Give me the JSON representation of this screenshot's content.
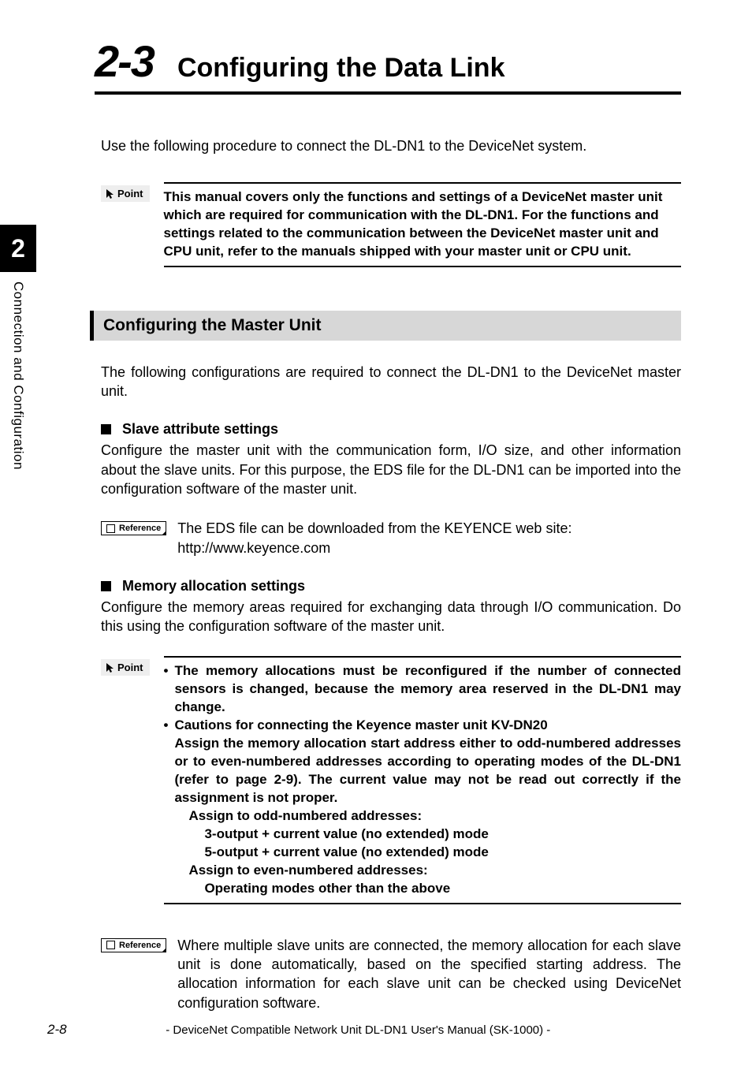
{
  "section_number": "2-3",
  "section_title": "Configuring the Data Link",
  "intro": "Use the following procedure to connect the DL-DN1 to the DeviceNet system.",
  "point_label": "Point",
  "point1_text": "This manual covers only the functions and settings of a DeviceNet master unit which are required for communication with the DL-DN1. For the functions and settings related to the communication between the DeviceNet master unit and CPU unit, refer to the manuals shipped with your master unit or CPU unit.",
  "subsection_title": "Configuring the Master Unit",
  "subsection_intro": "The following configurations are required to connect the DL-DN1 to the DeviceNet master unit.",
  "slave_heading": "Slave attribute settings",
  "slave_body": "Configure the master unit with the communication form, I/O size, and other information about the slave units. For this purpose, the EDS file for the DL-DN1 can be imported into the configuration software of the master unit.",
  "reference_label": "Reference",
  "ref1_line1": "The EDS file can be downloaded from the KEYENCE web site:",
  "ref1_line2": "http://www.keyence.com",
  "memory_heading": "Memory allocation settings",
  "memory_body": "Configure the memory areas required for exchanging data through I/O communication. Do this using the configuration software of the master unit.",
  "point2_bullet1": "The memory allocations must be reconfigured if the number of connected sensors is changed, because the memory area reserved in the DL-DN1 may change.",
  "point2_bullet2_l1": "Cautions for connecting the Keyence master unit KV-DN20",
  "point2_bullet2_l2": "Assign the memory allocation start address either to odd-numbered addresses or to even-numbered addresses according to operating modes of the DL-DN1 (refer to page 2-9). The current value may not be read out correctly if the assignment is not proper.",
  "point2_odd_h": "Assign to odd-numbered addresses:",
  "point2_odd_1": "3-output + current value (no extended) mode",
  "point2_odd_2": "5-output + current value (no extended) mode",
  "point2_even_h": "Assign to even-numbered addresses:",
  "point2_even_1": "Operating modes other than the above",
  "ref2_body": "Where multiple slave units are connected, the memory allocation for each slave unit is done automatically, based on the specified starting address. The allocation information for each slave unit can be checked using DeviceNet configuration software.",
  "side_tab_number": "2",
  "side_tab_text": "Connection and Configuration",
  "page_number": "2-8",
  "footer_title": "- DeviceNet Compatible Network Unit DL-DN1 User's Manual (SK-1000) -"
}
